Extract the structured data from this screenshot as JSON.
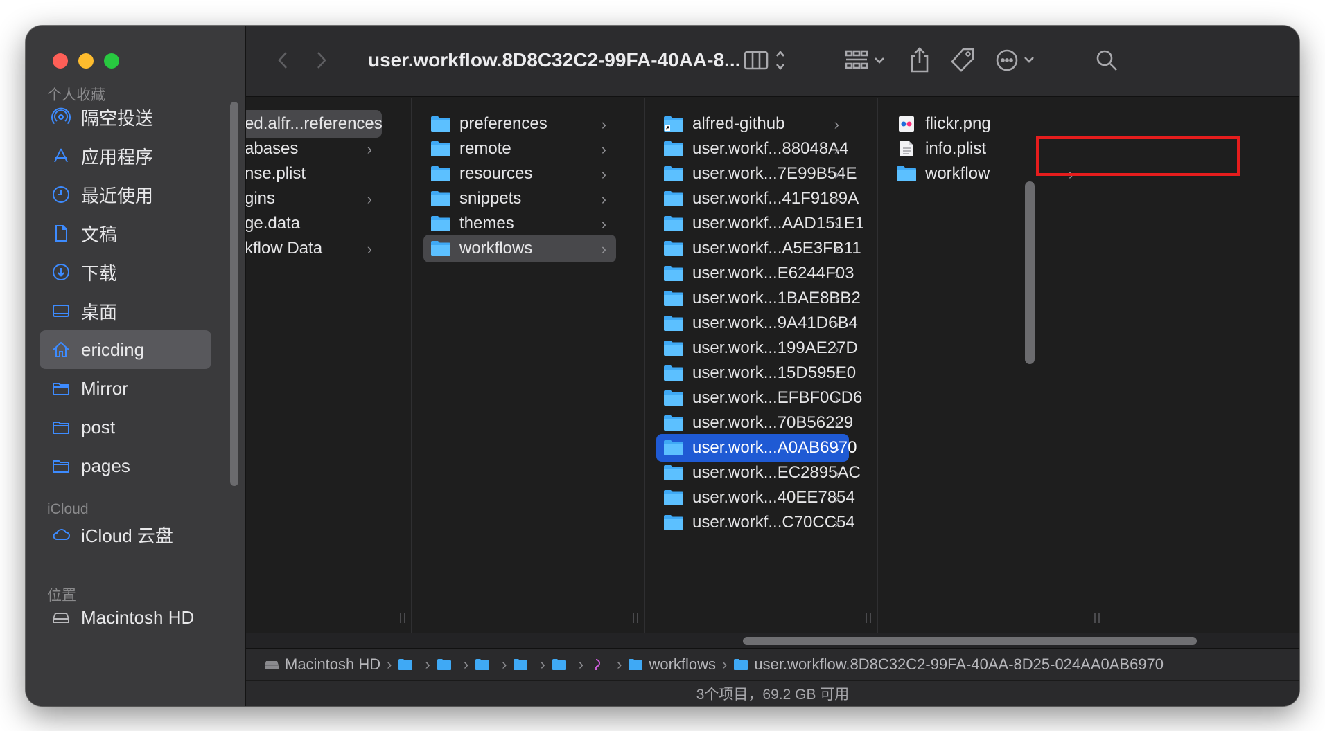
{
  "window": {
    "title": "user.workflow.8D8C32C2-99FA-40AA-8..."
  },
  "sidebar": {
    "favorites_header": "个人收藏",
    "favorites": [
      {
        "label": "隔空投送",
        "icon": "airdrop-icon"
      },
      {
        "label": "应用程序",
        "icon": "applications-icon"
      },
      {
        "label": "最近使用",
        "icon": "clock-icon"
      },
      {
        "label": "文稿",
        "icon": "document-icon"
      },
      {
        "label": "下载",
        "icon": "download-icon"
      },
      {
        "label": "桌面",
        "icon": "desktop-icon"
      },
      {
        "label": "ericding",
        "icon": "home-icon",
        "selected": true
      },
      {
        "label": "Mirror",
        "icon": "folder-icon"
      },
      {
        "label": "post",
        "icon": "folder-icon"
      },
      {
        "label": "pages",
        "icon": "folder-icon"
      }
    ],
    "icloud_header": "iCloud",
    "icloud": [
      {
        "label": "iCloud 云盘",
        "icon": "cloud-icon"
      }
    ],
    "locations_header": "位置",
    "locations": [
      {
        "label": "Macintosh HD",
        "icon": "disk-icon"
      }
    ]
  },
  "columns": {
    "col1": [
      {
        "label": "ed.alfr...references",
        "selected": true,
        "chevron": false
      },
      {
        "label": "abases",
        "chevron": true
      },
      {
        "label": "nse.plist",
        "chevron": false
      },
      {
        "label": "gins",
        "chevron": true
      },
      {
        "label": "ge.data",
        "chevron": false
      },
      {
        "label": "kflow Data",
        "chevron": true
      }
    ],
    "col2": [
      {
        "label": "preferences"
      },
      {
        "label": "remote"
      },
      {
        "label": "resources"
      },
      {
        "label": "snippets"
      },
      {
        "label": "themes"
      },
      {
        "label": "workflows",
        "selected": true
      }
    ],
    "col3": [
      {
        "label": "alfred-github",
        "alias": true
      },
      {
        "label": "user.workf...88048A4"
      },
      {
        "label": "user.work...7E99B54E"
      },
      {
        "label": "user.workf...41F9189A"
      },
      {
        "label": "user.workf...AAD151E1"
      },
      {
        "label": "user.workf...A5E3FB11"
      },
      {
        "label": "user.work...E6244F03"
      },
      {
        "label": "user.work...1BAE8BB2"
      },
      {
        "label": "user.work...9A41D6B4"
      },
      {
        "label": "user.work...199AE27D"
      },
      {
        "label": "user.work...15D595E0"
      },
      {
        "label": "user.work...EFBF0CD6"
      },
      {
        "label": "user.work...70B56229"
      },
      {
        "label": "user.work...A0AB6970",
        "active": true
      },
      {
        "label": "user.work...EC2895AC"
      },
      {
        "label": "user.work...40EE7854"
      },
      {
        "label": "user.workf...C70CC54"
      }
    ],
    "col4": [
      {
        "label": "flickr.png",
        "type": "image"
      },
      {
        "label": "info.plist",
        "type": "plist"
      },
      {
        "label": "workflow",
        "type": "folder",
        "highlighted": true
      }
    ]
  },
  "pathbar": {
    "segments": [
      "Macintosh HD",
      "",
      "",
      "",
      "",
      "",
      "",
      "workflows",
      "user.workflow.8D8C32C2-99FA-40AA-8D25-024AA0AB6970"
    ]
  },
  "status": "3个项目，69.2 GB 可用",
  "colors": {
    "accent": "#1f5ad4",
    "folder": "#3fa9f5",
    "highlight_box": "#e51d1d",
    "sidebar_icon": "#3d8bff"
  }
}
